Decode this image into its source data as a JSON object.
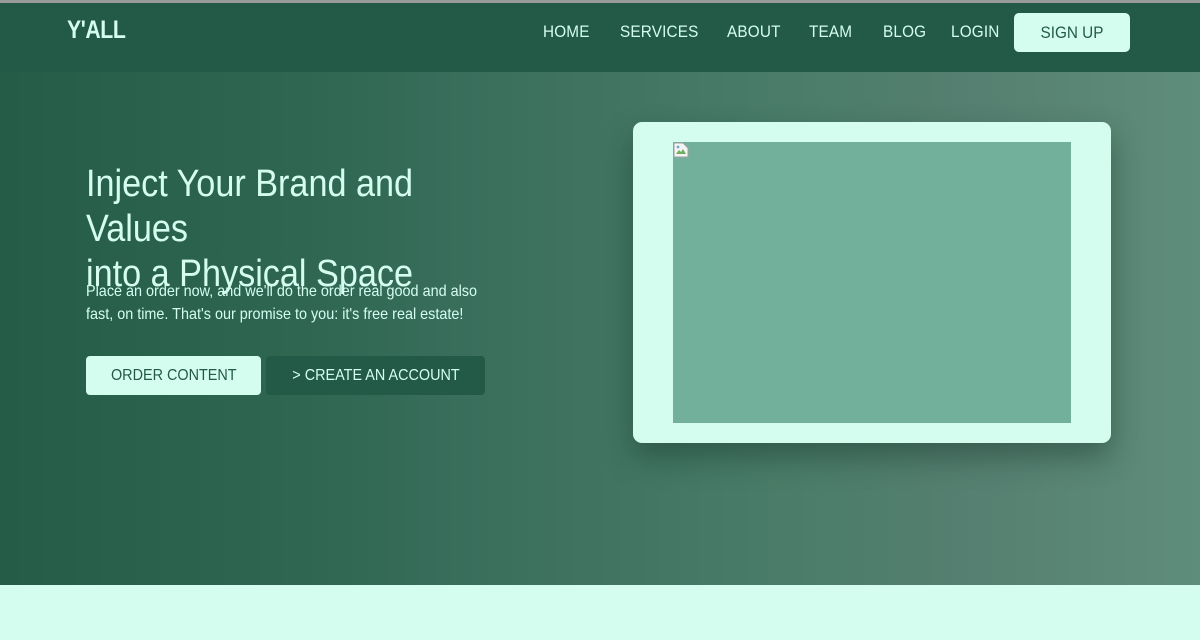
{
  "nav": {
    "logo": "Y'ALL",
    "links": [
      "HOME",
      "SERVICES",
      "ABOUT",
      "TEAM",
      "BLOG",
      "LOGIN"
    ],
    "signup_label": "SIGN UP"
  },
  "hero": {
    "headline_line1": "Inject Your Brand and Values",
    "headline_line2": "into a Physical Space",
    "subtext_line1": "Place an order now, and we'll do the order real good and also",
    "subtext_line2": "fast, on time. That's our promise to you: it's free real estate!",
    "order_button_label": "ORDER CONTENT",
    "create_button_label": "> CREATE AN ACCOUNT"
  },
  "media": {
    "icon": "broken-image-icon"
  },
  "colors": {
    "primary": "#235a47",
    "accent": "#d4fdf0",
    "media_fill": "#72b09c"
  }
}
